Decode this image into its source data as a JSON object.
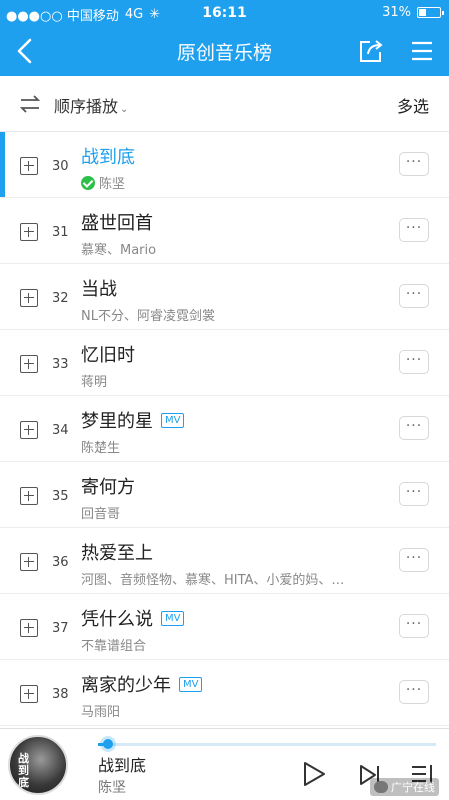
{
  "status_bar": {
    "carrier": "●●●○○ 中国移动",
    "network": "4G",
    "time": "16:11",
    "battery_text": "31%",
    "battery_level": 0.31
  },
  "nav": {
    "title": "原创音乐榜",
    "back_icon": "chevron-left-icon",
    "share_icon": "share-icon",
    "menu_icon": "hamburger-menu-icon"
  },
  "toolbar": {
    "play_order_label": "顺序播放",
    "multi_select_label": "多选"
  },
  "songs": [
    {
      "rank": "30",
      "title": "战到底",
      "artist": "陈坚",
      "mv": false,
      "active": true,
      "downloaded": true
    },
    {
      "rank": "31",
      "title": "盛世回首",
      "artist": "慕寒、Mario",
      "mv": false
    },
    {
      "rank": "32",
      "title": "当战",
      "artist": "NL不分、阿睿凌霓剑裳",
      "mv": false
    },
    {
      "rank": "33",
      "title": "忆旧时",
      "artist": "蒋明",
      "mv": false
    },
    {
      "rank": "34",
      "title": "梦里的星",
      "artist": "陈楚生",
      "mv": true
    },
    {
      "rank": "35",
      "title": "寄何方",
      "artist": "回音哥",
      "mv": false
    },
    {
      "rank": "36",
      "title": "热爱至上",
      "artist": "河图、音频怪物、慕寒、HITA、小爱的妈、…",
      "mv": false
    },
    {
      "rank": "37",
      "title": "凭什么说",
      "artist": "不靠谱组合",
      "mv": true
    },
    {
      "rank": "38",
      "title": "离家的少年",
      "artist": "马雨阳",
      "mv": true
    }
  ],
  "mv_badge": "MV",
  "more_label": "···",
  "player": {
    "cover_text": "战到底",
    "title": "战到底",
    "artist": "陈坚",
    "progress": 0.03,
    "watermark": "广宁在线"
  },
  "colors": {
    "accent": "#1ea0ef",
    "downloaded": "#2cc04a"
  }
}
